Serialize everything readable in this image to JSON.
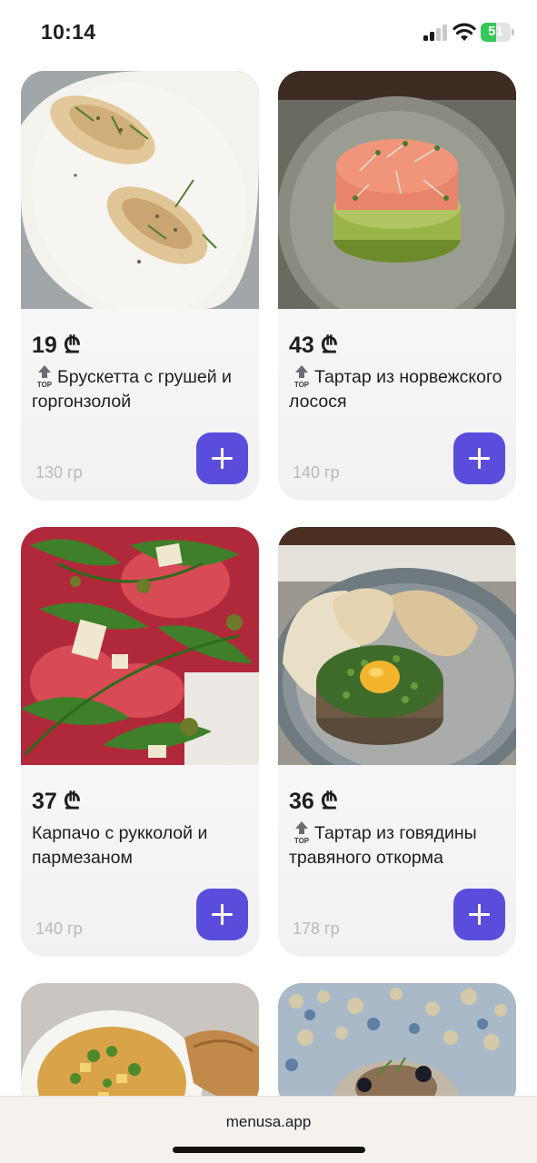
{
  "status_bar": {
    "time": "10:14",
    "battery_level": "51",
    "battery_fraction": 0.51,
    "battery_color": "#34c759"
  },
  "menu": {
    "accent_color": "#5b4ddb",
    "items": [
      {
        "price": "19 ₾",
        "name": "Брускетта с грушей и горгонзолой",
        "top": true,
        "weight": "130 гр",
        "image": "bruschetta-pear-gorgonzola-photo"
      },
      {
        "price": "43 ₾",
        "name": "Тартар из норвежского лосося",
        "top": true,
        "weight": "140 гр",
        "image": "salmon-tartare-photo"
      },
      {
        "price": "37 ₾",
        "name": "Карпачо с рукколой и пармезаном",
        "top": false,
        "weight": "140 гр",
        "image": "carpaccio-arugula-photo"
      },
      {
        "price": "36 ₾",
        "name": "Тартар из говядины травяного откорма",
        "top": true,
        "weight": "178 гр",
        "image": "beef-tartare-photo"
      },
      {
        "image": "soup-bowl-photo"
      },
      {
        "image": "mosaic-plate-dish-photo"
      }
    ]
  },
  "browser": {
    "url": "menusa.app"
  }
}
